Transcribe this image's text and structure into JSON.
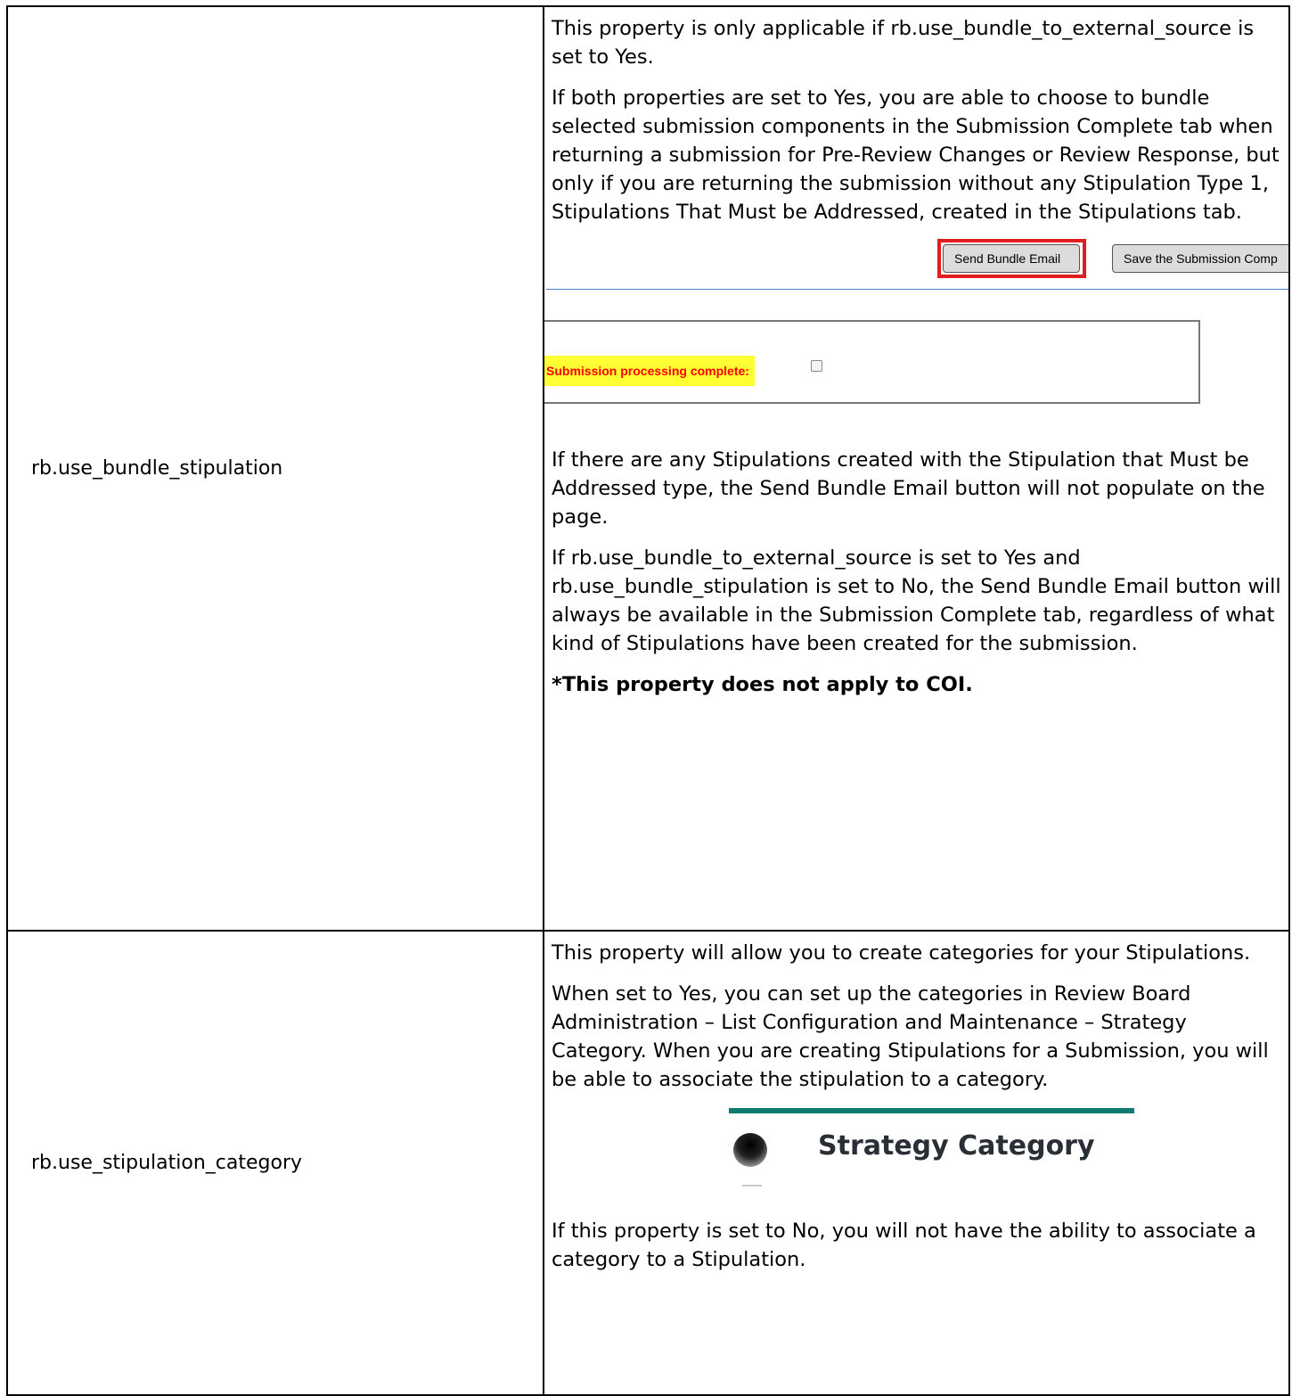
{
  "rows": [
    {
      "property": "rb.use_bundle_stipulation",
      "paragraphs": [
        "This property is only applicable if rb.use_bundle_to_external_source is set to Yes.",
        "If both properties are set to Yes, you are able to choose to bundle selected submission components in the Submission Complete tab when returning a submission for Pre-Review Changes or Review Response, but only if you are returning the submission without any Stipulation Type 1, Stipulations That Must be Addressed, created in the Stipulations tab."
      ],
      "screenshot": {
        "send_button": "Send Bundle Email",
        "save_button": "Save the Submission Comp",
        "complete_label": "Submission processing complete:",
        "highlight_color": "#e01e1e"
      },
      "paragraphs_after": [
        "If there are any Stipulations created with the Stipulation that Must be Addressed type, the Send Bundle Email button will not populate on the page.",
        "If rb.use_bundle_to_external_source is set to Yes and rb.use_bundle_stipulation is set to No, the Send Bundle Email button will always be available in the Submission Complete tab, regardless of what kind of Stipulations have been created for the submission."
      ],
      "note": "*This property does not apply to COI."
    },
    {
      "property": "rb.use_stipulation_category",
      "paragraphs": [
        "This property will allow you to create categories for your Stipulations.",
        "When set to Yes, you can set up the categories in Review Board Administration – List Configuration and Maintenance – Strategy Category. When you are creating Stipulations for a Submission, you will be able to associate the stipulation to a category."
      ],
      "screenshot": {
        "heading": "Strategy Category",
        "bar_color": "#0f7b74"
      },
      "paragraphs_after": [
        "If this property is set to No, you will not have the ability to associate a category to a Stipulation."
      ]
    }
  ]
}
